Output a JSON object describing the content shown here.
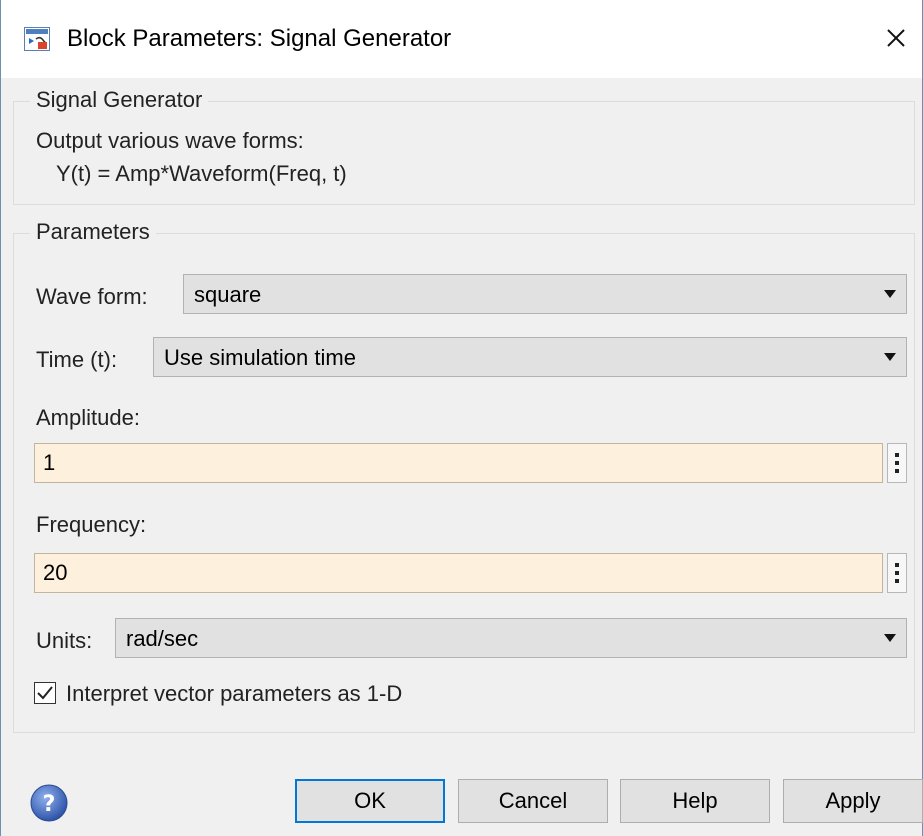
{
  "window": {
    "title": "Block Parameters: Signal Generator"
  },
  "description_group": {
    "legend": "Signal Generator",
    "line1": "Output various wave forms:",
    "line2": "Y(t) = Amp*Waveform(Freq, t)"
  },
  "parameters": {
    "legend": "Parameters",
    "wave_form": {
      "label": "Wave form:",
      "value": "square"
    },
    "time": {
      "label": "Time (t):",
      "value": "Use simulation time"
    },
    "amplitude": {
      "label": "Amplitude:",
      "value": "1"
    },
    "frequency": {
      "label": "Frequency:",
      "value": "20"
    },
    "units": {
      "label": "Units:",
      "value": "rad/sec"
    },
    "interpret_vector": {
      "label": "Interpret vector parameters as 1-D",
      "checked": true
    }
  },
  "buttons": {
    "ok": "OK",
    "cancel": "Cancel",
    "help": "Help",
    "apply": "Apply"
  },
  "icons": {
    "app": "simulink-block-icon",
    "close": "close-icon",
    "help": "help-circle-icon",
    "field_options": "vertical-ellipsis-icon"
  },
  "colors": {
    "editable_field_bg": "#fdf0dc",
    "default_button_border": "#0078d7",
    "help_icon": "#3a63b8"
  }
}
